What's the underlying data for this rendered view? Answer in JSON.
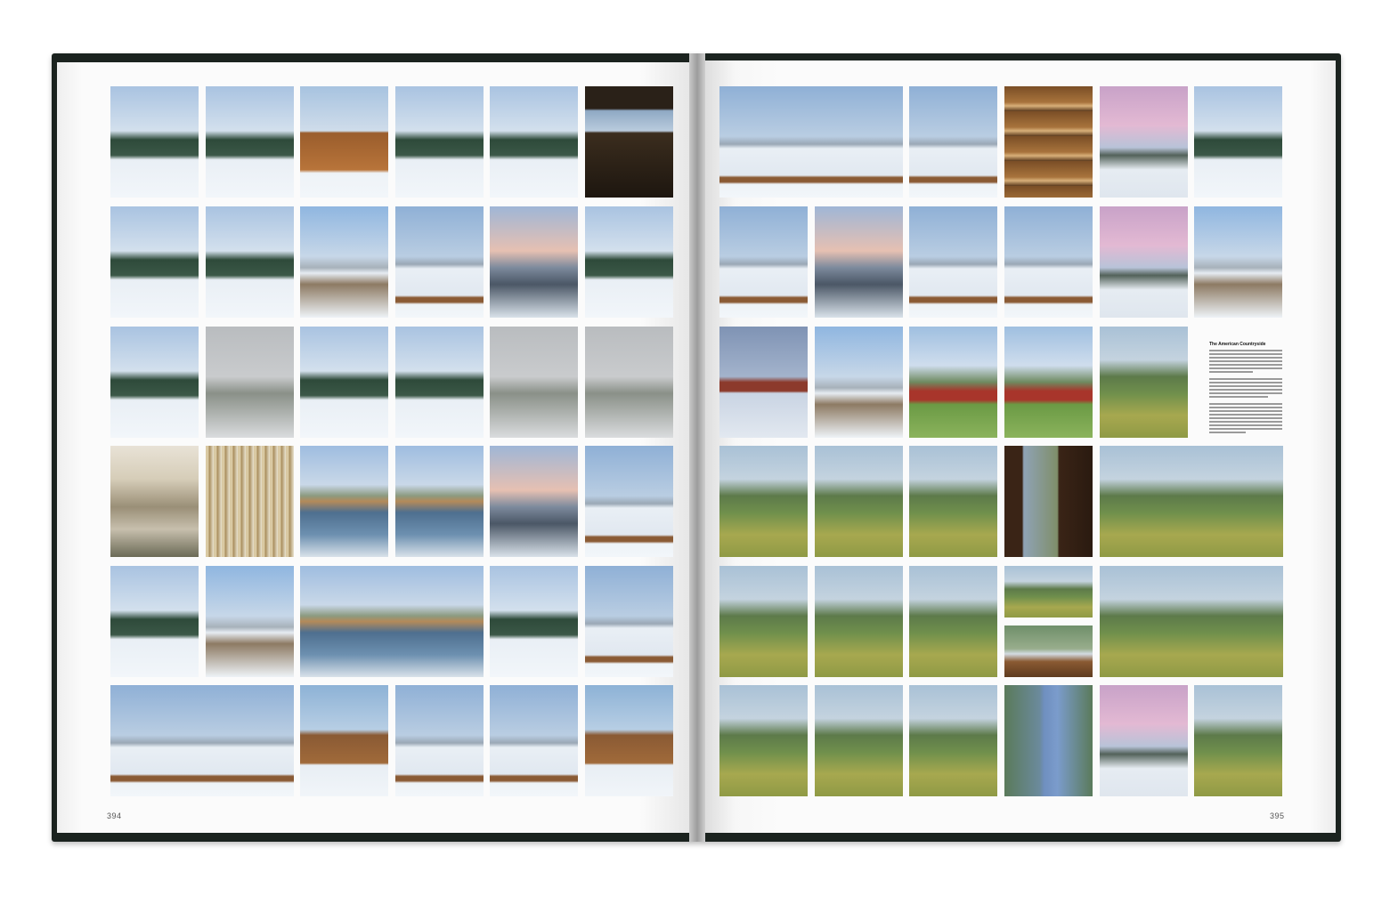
{
  "book": {
    "left_page_number": "394",
    "right_page_number": "395",
    "sidebar_heading": "The American Countryside"
  },
  "colors": {
    "cover": "#1b231f",
    "paper": "#fbfbfb",
    "gutter_shadow": "#9c9c9c"
  },
  "photos_left": [
    [
      "snowy-pine-forest",
      "snow-covered-fir-trees",
      "ski-lodge-cabin",
      "skier-on-slope",
      "ski-lift-in-snowy-forest",
      "lodge-interior-window"
    ],
    [
      "chairlift-over-slope",
      "snowy-forest-trail",
      "snowy-valley-road",
      "horse-behind-fence",
      "mountain-town-at-dusk",
      "frosted-tree-on-hill"
    ],
    [
      "snowy-hillside-trees",
      "orange-cabin-in-fog",
      "evergreen-forest",
      "snowy-mountain-range",
      "foggy-frozen-forest",
      "lone-fir-in-fog"
    ],
    [
      "valley-town-aerial",
      "aspen-grove-in-snow",
      "icy-river-bend",
      "creek-with-shrubs",
      "frozen-lake-at-dawn",
      "horse-by-power-pole"
    ],
    [
      "snowy-field-row-trees",
      "plowed-country-road",
      "mountain-lake-reflection",
      "fenced-snowy-pasture",
      "horse-grazing-in-snow"
    ],
    [
      "horses-in-snow-field",
      "saddled-horse-by-trailer",
      "horses-in-snowfield",
      "rider-in-snowfield",
      "rider-boots-close-up"
    ]
  ],
  "photos_right": [
    [
      "cowboys-riding-in-snow",
      "rider-on-snow-plain",
      "cowboy-boots-rack",
      "pink-sky-over-mountains",
      "barn-and-pasture"
    ],
    [
      "horses-running-in-snow",
      "horses-at-dusk",
      "horse-lying-in-snow",
      "horse-in-snowy-paddock",
      "pink-sunset-over-valley",
      "road-through-valley"
    ],
    [
      "red-barn-in-snowstorm",
      "snowy-rural-road",
      "red-barn-in-valley",
      "red-barn-green-meadow",
      "summer-meadow-hay-bales"
    ],
    [
      "green-mountain-pasture",
      "wooden-barn-with-fence",
      "old-cabin-in-meadow",
      "cabin-window-view",
      "riders-crossing-meadow"
    ],
    [
      "horses-on-green-slope",
      "corral-in-valley",
      "rider-on-trail",
      "cowboy-on-fence",
      "hat-on-truck-dash",
      "horses-by-wooden-fence"
    ],
    [
      "green-field-at-dusk",
      "country-road-power-lines",
      "person-by-mountain-lake",
      "woman-with-straw-hat",
      "mountain-at-sunset",
      "van-in-meadow"
    ]
  ]
}
